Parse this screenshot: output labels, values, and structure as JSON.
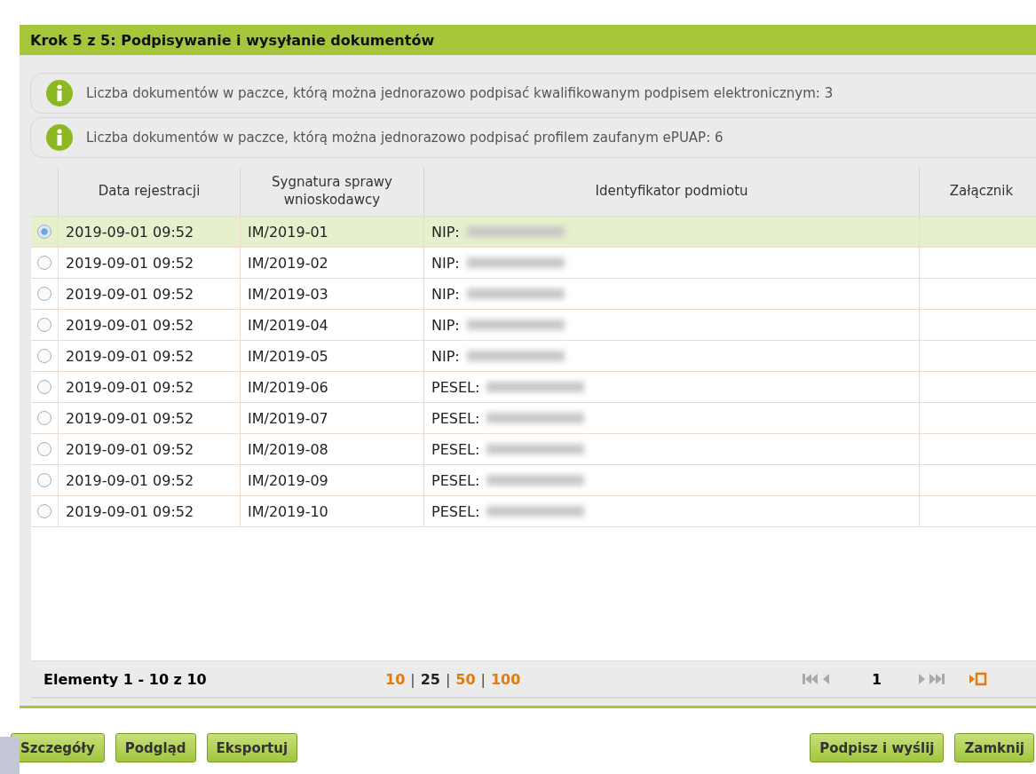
{
  "title": "Krok 5 z 5: Podpisywanie i wysyłanie dokumentów",
  "notices": [
    "Liczba dokumentów w paczce, którą można jednorazowo podpisać kwalifikowanym podpisem elektronicznym: 3",
    "Liczba dokumentów w paczce, którą można jednorazowo podpisać profilem zaufanym ePUAP: 6"
  ],
  "table": {
    "columns": [
      "Data rejestracji",
      "Sygnatura sprawy wnioskodawcy",
      "Identyfikator podmiotu",
      "Załącznik"
    ],
    "rows": [
      {
        "selected": true,
        "date": "2019-09-01 09:52",
        "signature": "IM/2019-01",
        "id_label": "NIP:"
      },
      {
        "selected": false,
        "date": "2019-09-01 09:52",
        "signature": "IM/2019-02",
        "id_label": "NIP:"
      },
      {
        "selected": false,
        "date": "2019-09-01 09:52",
        "signature": "IM/2019-03",
        "id_label": "NIP:"
      },
      {
        "selected": false,
        "date": "2019-09-01 09:52",
        "signature": "IM/2019-04",
        "id_label": "NIP:"
      },
      {
        "selected": false,
        "date": "2019-09-01 09:52",
        "signature": "IM/2019-05",
        "id_label": "NIP:"
      },
      {
        "selected": false,
        "date": "2019-09-01 09:52",
        "signature": "IM/2019-06",
        "id_label": "PESEL:"
      },
      {
        "selected": false,
        "date": "2019-09-01 09:52",
        "signature": "IM/2019-07",
        "id_label": "PESEL:"
      },
      {
        "selected": false,
        "date": "2019-09-01 09:52",
        "signature": "IM/2019-08",
        "id_label": "PESEL:"
      },
      {
        "selected": false,
        "date": "2019-09-01 09:52",
        "signature": "IM/2019-09",
        "id_label": "PESEL:"
      },
      {
        "selected": false,
        "date": "2019-09-01 09:52",
        "signature": "IM/2019-10",
        "id_label": "PESEL:"
      }
    ]
  },
  "pager": {
    "summary": "Elementy 1 - 10 z 10",
    "page_sizes": [
      {
        "label": "10",
        "selected": false
      },
      {
        "label": "25",
        "selected": true
      },
      {
        "label": "50",
        "selected": false
      },
      {
        "label": "100",
        "selected": false
      }
    ],
    "page": "1",
    "separator": "|"
  },
  "buttons_left": [
    "Szczegóły",
    "Podgląd",
    "Eksportuj"
  ],
  "buttons_right": [
    "Podpisz i wyślij",
    "Zamknij"
  ]
}
